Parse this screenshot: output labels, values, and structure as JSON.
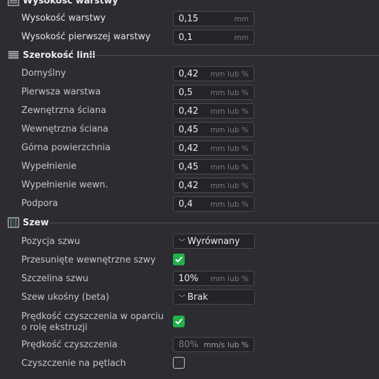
{
  "sections": {
    "layer_height": {
      "title": "Wysokość warstwy"
    },
    "line_width": {
      "title": "Szerokość linii"
    },
    "seam": {
      "title": "Szew"
    }
  },
  "layer_height_rows": [
    {
      "label": "Wysokość warstwy",
      "value": "0,15",
      "unit": "mm"
    },
    {
      "label": "Wysokość pierwszej warstwy",
      "value": "0,1",
      "unit": "mm"
    }
  ],
  "line_width_rows": [
    {
      "label": "Domyślny",
      "value": "0,42",
      "unit": "mm lub %"
    },
    {
      "label": "Pierwsza warstwa",
      "value": "0,5",
      "unit": "mm lub %"
    },
    {
      "label": "Zewnętrzna ściana",
      "value": "0,42",
      "unit": "mm lub %"
    },
    {
      "label": "Wewnętrzna ściana",
      "value": "0,45",
      "unit": "mm lub %"
    },
    {
      "label": "Górna powierzchnia",
      "value": "0,42",
      "unit": "mm lub %"
    },
    {
      "label": "Wypełnienie",
      "value": "0,45",
      "unit": "mm lub %"
    },
    {
      "label": "Wypełnienie wewn.",
      "value": "0,42",
      "unit": "mm lub %"
    },
    {
      "label": "Podpora",
      "value": "0,4",
      "unit": "mm lub %"
    }
  ],
  "seam": {
    "position_label": "Pozycja szwu",
    "position_value": "Wyrównany",
    "staggered_label": "Przesunięte wewnętrzne szwy",
    "staggered_checked": true,
    "gap_label": "Szczelina szwu",
    "gap_value": "10%",
    "gap_unit": "mm lub %",
    "scarf_label": "Szew ukośny (beta)",
    "scarf_value": "Brak",
    "wipe_role_label_line1": "Prędkość czyszczenia w oparciu",
    "wipe_role_label_line2": "o rolę ekstruzji",
    "wipe_role_checked": true,
    "wipe_speed_label": "Prędkość czyszczenia",
    "wipe_speed_value": "80%",
    "wipe_speed_unit": "mm/s lub %",
    "wipe_loop_label": "Czyszczenie na pętlach",
    "wipe_loop_checked": false
  },
  "colors": {
    "background": "#2d2d31",
    "accent_green": "#22b14c"
  }
}
